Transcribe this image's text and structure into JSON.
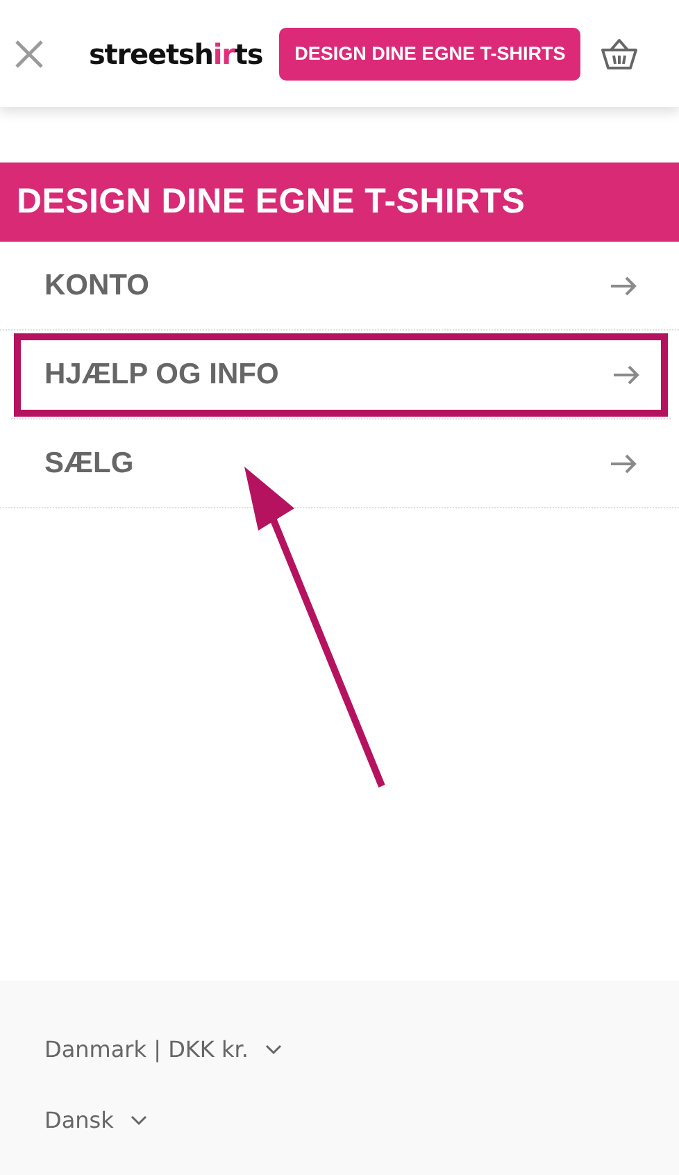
{
  "header": {
    "logo": [
      {
        "text": "streetsh",
        "accent": false
      },
      {
        "text": "ir",
        "accent": true
      },
      {
        "text": "ts",
        "accent": false
      }
    ],
    "cta": "DESIGN DINE EGNE T-SHIRTS"
  },
  "menu": {
    "title": "DESIGN DINE EGNE T-SHIRTS",
    "items": [
      {
        "label": "KONTO",
        "highlighted": false
      },
      {
        "label": "HJÆLP OG INFO",
        "highlighted": true
      },
      {
        "label": "SÆLG",
        "highlighted": false
      }
    ]
  },
  "annotation": {
    "kind": "arrow"
  },
  "footer": {
    "selectors": [
      "Danmark | DKK kr.",
      "Dansk"
    ]
  }
}
